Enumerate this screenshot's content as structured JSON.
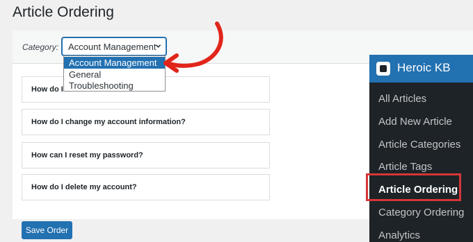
{
  "page": {
    "title": "Article Ordering"
  },
  "filter": {
    "label": "Category:",
    "selected": "Account Management",
    "options": [
      "Account Management",
      "General",
      "Troubleshooting"
    ]
  },
  "articles": [
    "How do I create an account?",
    "How do I change my account information?",
    "How can I reset my password?",
    "How do I delete my account?"
  ],
  "save_label": "Save Order",
  "sidebar": {
    "title": "Heroic KB",
    "items": [
      "All Articles",
      "Add New Article",
      "Article Categories",
      "Article Tags",
      "Article Ordering",
      "Category Ordering",
      "Analytics"
    ],
    "active_index": 4
  },
  "colors": {
    "accent": "#2271b1",
    "sidebar_bg": "#1d2327",
    "highlight": "#d63638"
  }
}
